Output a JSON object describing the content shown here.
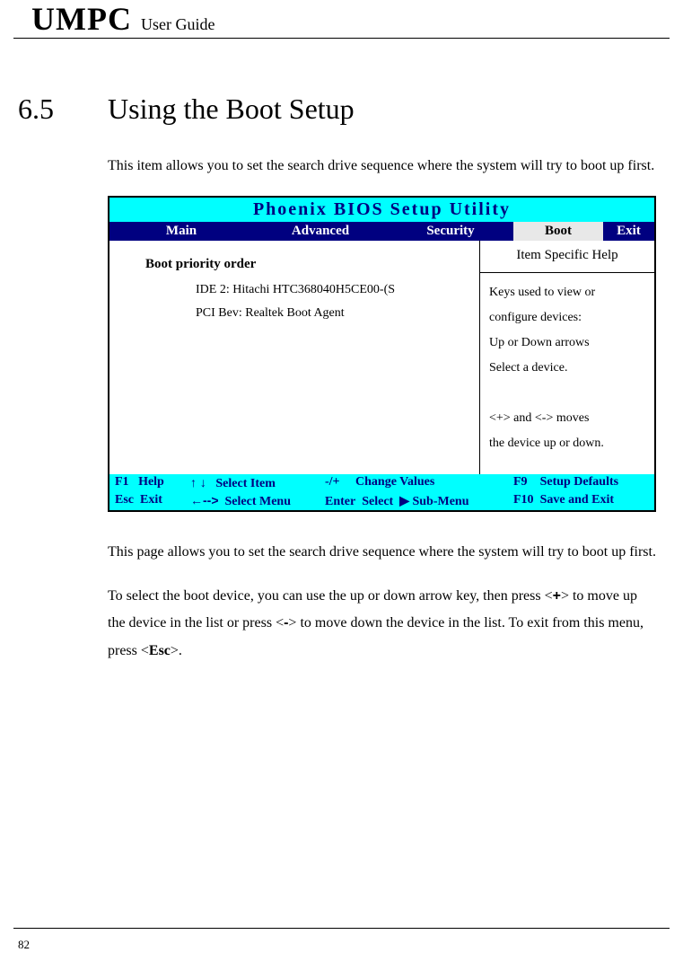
{
  "header": {
    "brand": "UMPC",
    "subtitle": "User Guide"
  },
  "section": {
    "number": "6.5",
    "heading": "Using the Boot Setup"
  },
  "p1": "This item allows you to set the search drive sequence where the system will try to boot up first.",
  "bios": {
    "title": "Phoenix BIOS Setup Utility",
    "tabs": {
      "main": "Main",
      "advanced": "Advanced",
      "security": "Security",
      "boot": "Boot",
      "exit": "Exit"
    },
    "boot_priority_label": "Boot priority order",
    "boot_items": [
      "IDE 2: Hitachi HTC368040H5CE00-(S",
      "PCI Bev: Realtek Boot Agent"
    ],
    "help": {
      "heading": "Item Specific Help",
      "line1": "Keys used to view or",
      "line2": "configure devices:",
      "line3": "Up or Down arrows",
      "line4": "Select a device.",
      "line5": "<+> and <-> moves",
      "line6": "the device up or down."
    },
    "footer": {
      "r1c1a": "F1",
      "r1c1b": "Help",
      "r1c2_arrows": "↑ ↓",
      "r1c2_label": "Select Item",
      "r1c3a": "-/+",
      "r1c3b": "Change Values",
      "r1c4a": "F9",
      "r1c4b": "Setup Defaults",
      "r2c1a": "Esc",
      "r2c1b": "Exit",
      "r2c2_arrow": "←-->",
      "r2c2_label": "Select Menu",
      "r2c3a": "Enter",
      "r2c3b": "Select",
      "r2c3_arrow": "▶",
      "r2c3c": "Sub-Menu",
      "r2c4a": "F10",
      "r2c4b": "Save and Exit"
    }
  },
  "p2": "This page allows you to set the search drive sequence where the system will try to boot up first.",
  "p3_pre": "To select the boot device, you can use the up or down arrow key, then press <",
  "p3_k1": "+",
  "p3_mid1": "> to move up the device in the list or press <",
  "p3_k2": "-",
  "p3_mid2": "> to move down the device in the list. To exit from this menu, press <",
  "p3_k3": "Esc",
  "p3_post": ">.",
  "page_number": "82"
}
